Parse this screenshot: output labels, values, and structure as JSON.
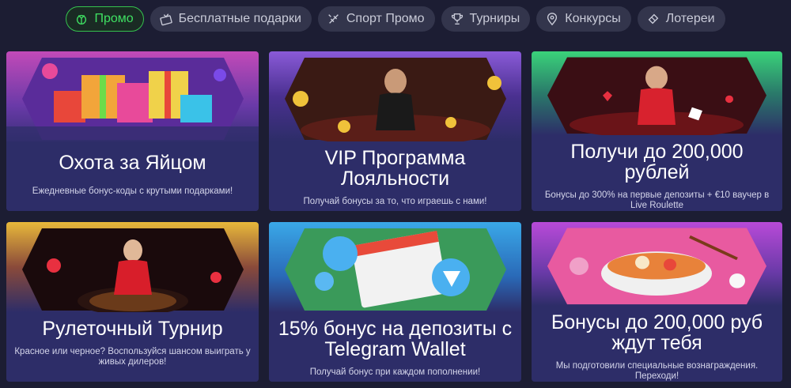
{
  "tabs": [
    {
      "label": "Промо",
      "icon": "gift-icon",
      "active": true
    },
    {
      "label": "Бесплатные подарки",
      "icon": "gift-box-icon",
      "active": false
    },
    {
      "label": "Спорт Промо",
      "icon": "sport-icon",
      "active": false
    },
    {
      "label": "Турниры",
      "icon": "trophy-icon",
      "active": false
    },
    {
      "label": "Конкурсы",
      "icon": "location-pin-icon",
      "active": false
    },
    {
      "label": "Лотереи",
      "icon": "ticket-icon",
      "active": false
    }
  ],
  "cards": [
    {
      "title": "Охота за Яйцом",
      "subtitle": "Ежедневные бонус-коды с крутыми подарками!",
      "image": "gift-boxes-image"
    },
    {
      "title": "VIP Программа Лояльности",
      "subtitle": "Получай бонусы за то, что играешь с нами!",
      "image": "vip-dealer-image"
    },
    {
      "title": "Получи до 200,000 рублей",
      "subtitle": "Бонусы до 300% на первые депозиты + €10 ваучер в Live Roulette",
      "image": "live-roulette-dealer-image"
    },
    {
      "title": "Рулеточный Турнир",
      "subtitle": "Красное или черное? Воспользуйся шансом выиграть у живых дилеров!",
      "image": "roulette-table-image"
    },
    {
      "title": "15% бонус на депозиты с Telegram Wallet",
      "subtitle": "Получай бонус при каждом пополнении!",
      "image": "telegram-wallet-image"
    },
    {
      "title": "Бонусы до 200,000 руб ждут тебя",
      "subtitle": "Мы подготовили специальные вознаграждения. Переходи!",
      "image": "noodle-bowl-image"
    }
  ],
  "colors": {
    "background": "#1c1d33",
    "tab_bg": "#33354c",
    "tab_active_border": "#35c24e",
    "tab_active_text": "#3fe062",
    "card_body": "#2d2d68"
  }
}
